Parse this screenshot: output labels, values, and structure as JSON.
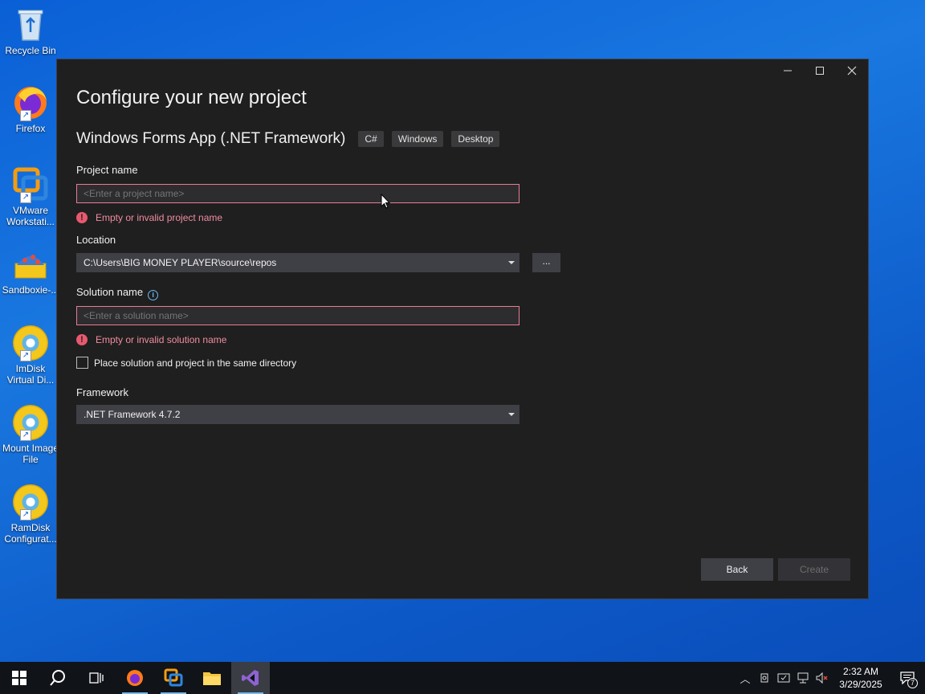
{
  "desktop": {
    "icons": [
      {
        "label": "Recycle Bin"
      },
      {
        "label": "Firefox"
      },
      {
        "label": "VMware Workstati..."
      },
      {
        "label": "Sandboxie-..."
      },
      {
        "label": "ImDisk Virtual Di..."
      },
      {
        "label": "Mount Image File"
      },
      {
        "label": "RamDisk Configurat..."
      }
    ]
  },
  "dialog": {
    "title": "Configure your new project",
    "template_name": "Windows Forms App (.NET Framework)",
    "tags": [
      "C#",
      "Windows",
      "Desktop"
    ],
    "project_name": {
      "label": "Project name",
      "placeholder": "<Enter a project name>",
      "error": "Empty or invalid project name"
    },
    "location": {
      "label": "Location",
      "value": "C:\\Users\\BIG MONEY PLAYER\\source\\repos",
      "browse_label": "..."
    },
    "solution_name": {
      "label": "Solution name",
      "placeholder": "<Enter a solution name>",
      "error": "Empty or invalid solution name"
    },
    "same_directory": {
      "label": "Place solution and project in the same directory",
      "checked": false
    },
    "framework": {
      "label": "Framework",
      "value": ".NET Framework 4.7.2"
    },
    "buttons": {
      "back": "Back",
      "create": "Create"
    }
  },
  "taskbar": {
    "clock_time": "2:32 AM",
    "clock_date": "3/29/2025",
    "notification_count": "7"
  },
  "colors": {
    "dialog_bg": "#1f1f1f",
    "error": "#f08ca0",
    "error_border": "#e87c94",
    "accent": "#76b9ed"
  }
}
